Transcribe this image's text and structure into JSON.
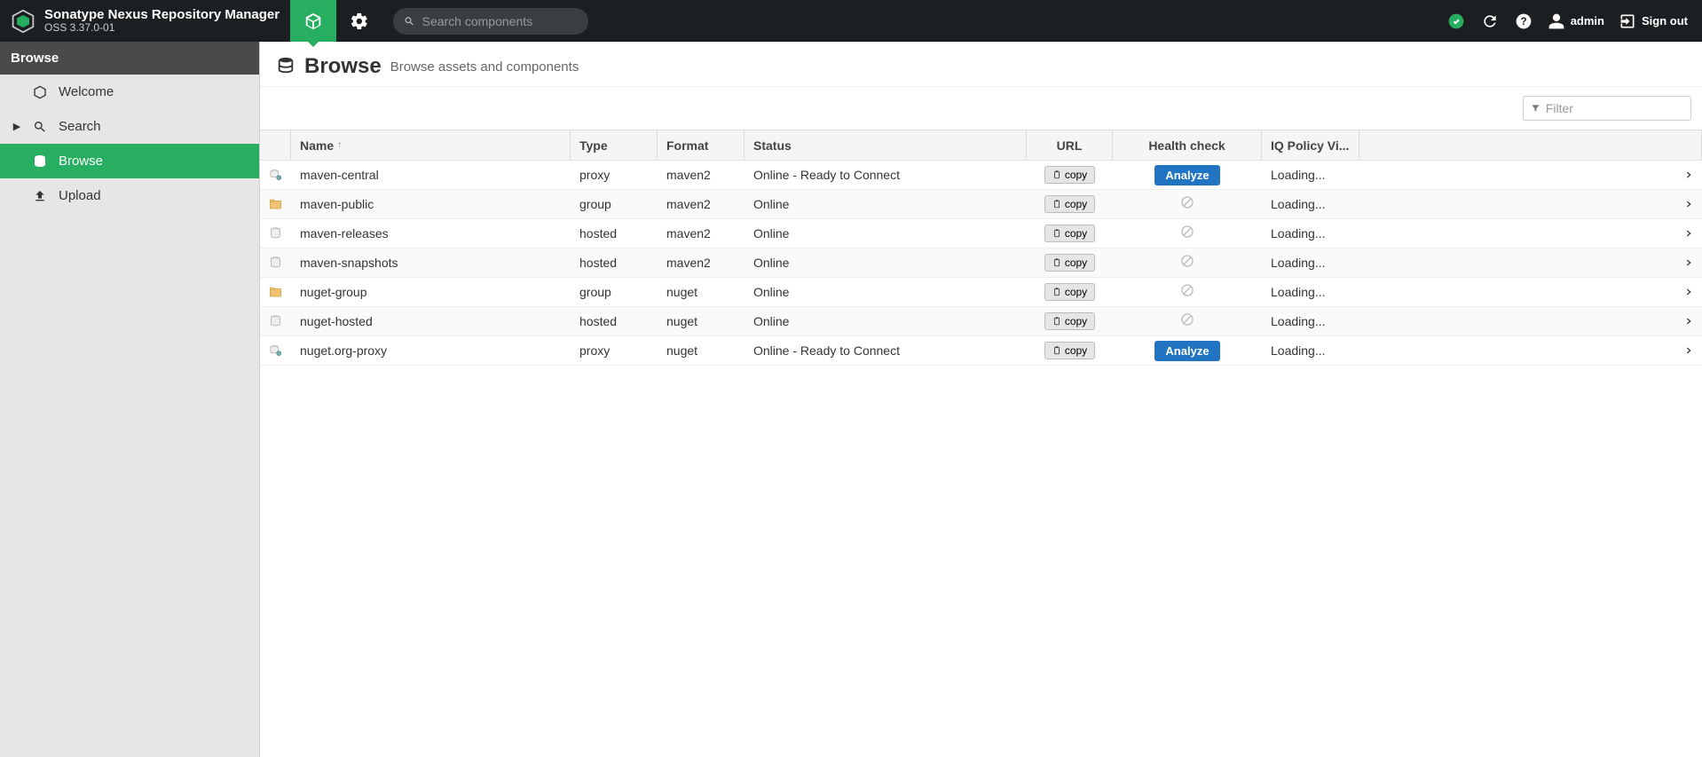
{
  "header": {
    "product_name": "Sonatype Nexus Repository Manager",
    "version": "OSS 3.37.0-01",
    "search_placeholder": "Search components",
    "username": "admin",
    "signout_label": "Sign out"
  },
  "sidebar": {
    "section_title": "Browse",
    "items": [
      {
        "label": "Welcome",
        "icon": "hexagon"
      },
      {
        "label": "Search",
        "icon": "search",
        "expandable": true
      },
      {
        "label": "Browse",
        "icon": "database",
        "selected": true
      },
      {
        "label": "Upload",
        "icon": "upload"
      }
    ]
  },
  "page": {
    "title": "Browse",
    "description": "Browse assets and components",
    "filter_placeholder": "Filter"
  },
  "table": {
    "columns": {
      "name": "Name",
      "type": "Type",
      "format": "Format",
      "status": "Status",
      "url": "URL",
      "health": "Health check",
      "iq": "IQ Policy Vi..."
    },
    "copy_label": "copy",
    "analyze_label": "Analyze",
    "loading_label": "Loading...",
    "rows": [
      {
        "name": "maven-central",
        "type": "proxy",
        "format": "maven2",
        "status": "Online - Ready to Connect",
        "health": "analyze",
        "icon": "proxy"
      },
      {
        "name": "maven-public",
        "type": "group",
        "format": "maven2",
        "status": "Online",
        "health": "na",
        "icon": "group"
      },
      {
        "name": "maven-releases",
        "type": "hosted",
        "format": "maven2",
        "status": "Online",
        "health": "na",
        "icon": "hosted"
      },
      {
        "name": "maven-snapshots",
        "type": "hosted",
        "format": "maven2",
        "status": "Online",
        "health": "na",
        "icon": "hosted"
      },
      {
        "name": "nuget-group",
        "type": "group",
        "format": "nuget",
        "status": "Online",
        "health": "na",
        "icon": "group"
      },
      {
        "name": "nuget-hosted",
        "type": "hosted",
        "format": "nuget",
        "status": "Online",
        "health": "na",
        "icon": "hosted"
      },
      {
        "name": "nuget.org-proxy",
        "type": "proxy",
        "format": "nuget",
        "status": "Online - Ready to Connect",
        "health": "analyze",
        "icon": "proxy"
      }
    ]
  }
}
